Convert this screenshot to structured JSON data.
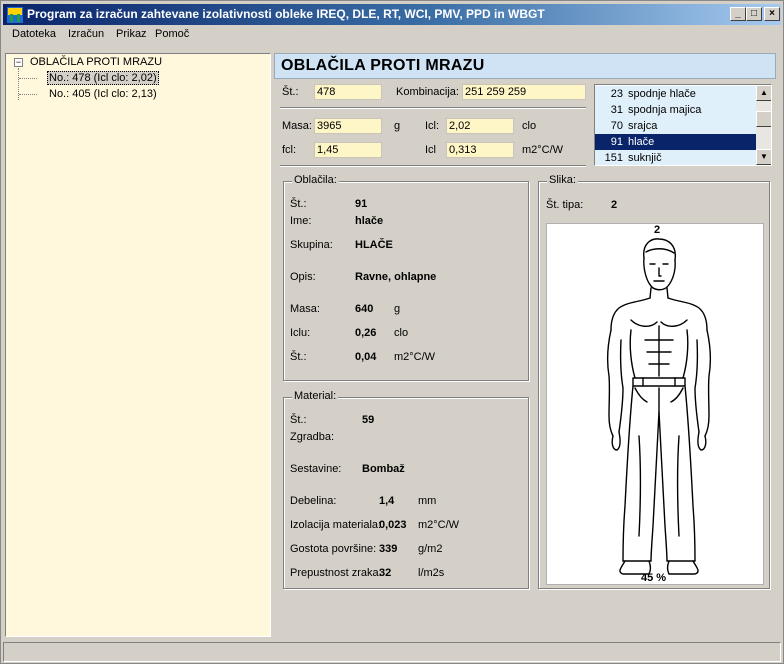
{
  "window": {
    "title": "Program za izračun zahtevane izolativnosti obleke IREQ, DLE, RT, WCI, PMV, PPD in WBGT",
    "min_label": "_",
    "max_label": "□",
    "close_label": "×"
  },
  "menu": [
    "Datoteka",
    "Izračun",
    "Prikaz",
    "Pomoč"
  ],
  "tree": {
    "root": "OBLAČILA PROTI MRAZU",
    "children": [
      "No.: 478 (Icl clo: 2,02)",
      "No.: 405 (Icl clo: 2,13)"
    ],
    "expander": "−"
  },
  "header": {
    "title": "OBLAČILA PROTI MRAZU"
  },
  "ensemble": {
    "st_label": "Št.:",
    "st_value": "478",
    "komb_label": "Kombinacija:",
    "komb_value": "251 259 259",
    "masa_label": "Masa:",
    "masa_value": "3965",
    "masa_unit": "g",
    "icl_label": "Icl:",
    "icl_value": "2,02",
    "icl_unit": "clo",
    "fcl_label": "fcl:",
    "fcl_value": "1,45",
    "icl2_label": "Icl",
    "icl2_value": "0,313",
    "icl2_unit": "m2°C/W"
  },
  "listbox": {
    "items": [
      {
        "num": "23",
        "text": "spodnje hlače"
      },
      {
        "num": "31",
        "text": "spodnja majica"
      },
      {
        "num": "70",
        "text": "srajca"
      },
      {
        "num": "91",
        "text": "hlače"
      },
      {
        "num": "151",
        "text": "suknjič"
      }
    ],
    "selected_index": 3,
    "up_arrow": "▲",
    "down_arrow": "▼"
  },
  "oblacila": {
    "title": "Oblačila:",
    "st_label": "Št.:",
    "st_value": "91",
    "ime_label": "Ime:",
    "ime_value": "hlače",
    "skupina_label": "Skupina:",
    "skupina_value": "HLAČE",
    "opis_label": "Opis:",
    "opis_value": "Ravne, ohlapne",
    "masa_label": "Masa:",
    "masa_value": "640",
    "masa_unit": "g",
    "iclu_label": "Iclu:",
    "iclu_value": "0,26",
    "iclu_unit": "clo",
    "st2_label": "Št.:",
    "st2_value": "0,04",
    "st2_unit": "m2°C/W"
  },
  "material": {
    "title": "Material:",
    "st_label": "Št.:",
    "st_value": "59",
    "zgradba_label": "Zgradba:",
    "sestavine_label": "Sestavine:",
    "sestavine_value": "Bombaž",
    "debelina_label": "Debelina:",
    "debelina_value": "1,4",
    "debelina_unit": "mm",
    "izolacija_label": "Izolacija materiala:",
    "izolacija_value": "0,023",
    "izolacija_unit": "m2°C/W",
    "gostota_label": "Gostota površine:",
    "gostota_value": "339",
    "gostota_unit": "g/m2",
    "prepustnost_label": "Prepustnost zraka:",
    "prepustnost_value": "32",
    "prepustnost_unit": "l/m2s"
  },
  "slika": {
    "title": "Slika:",
    "st_tipa_label": "Št. tipa:",
    "st_tipa_value": "2",
    "image_number": "2",
    "image_percent": "45 %"
  }
}
